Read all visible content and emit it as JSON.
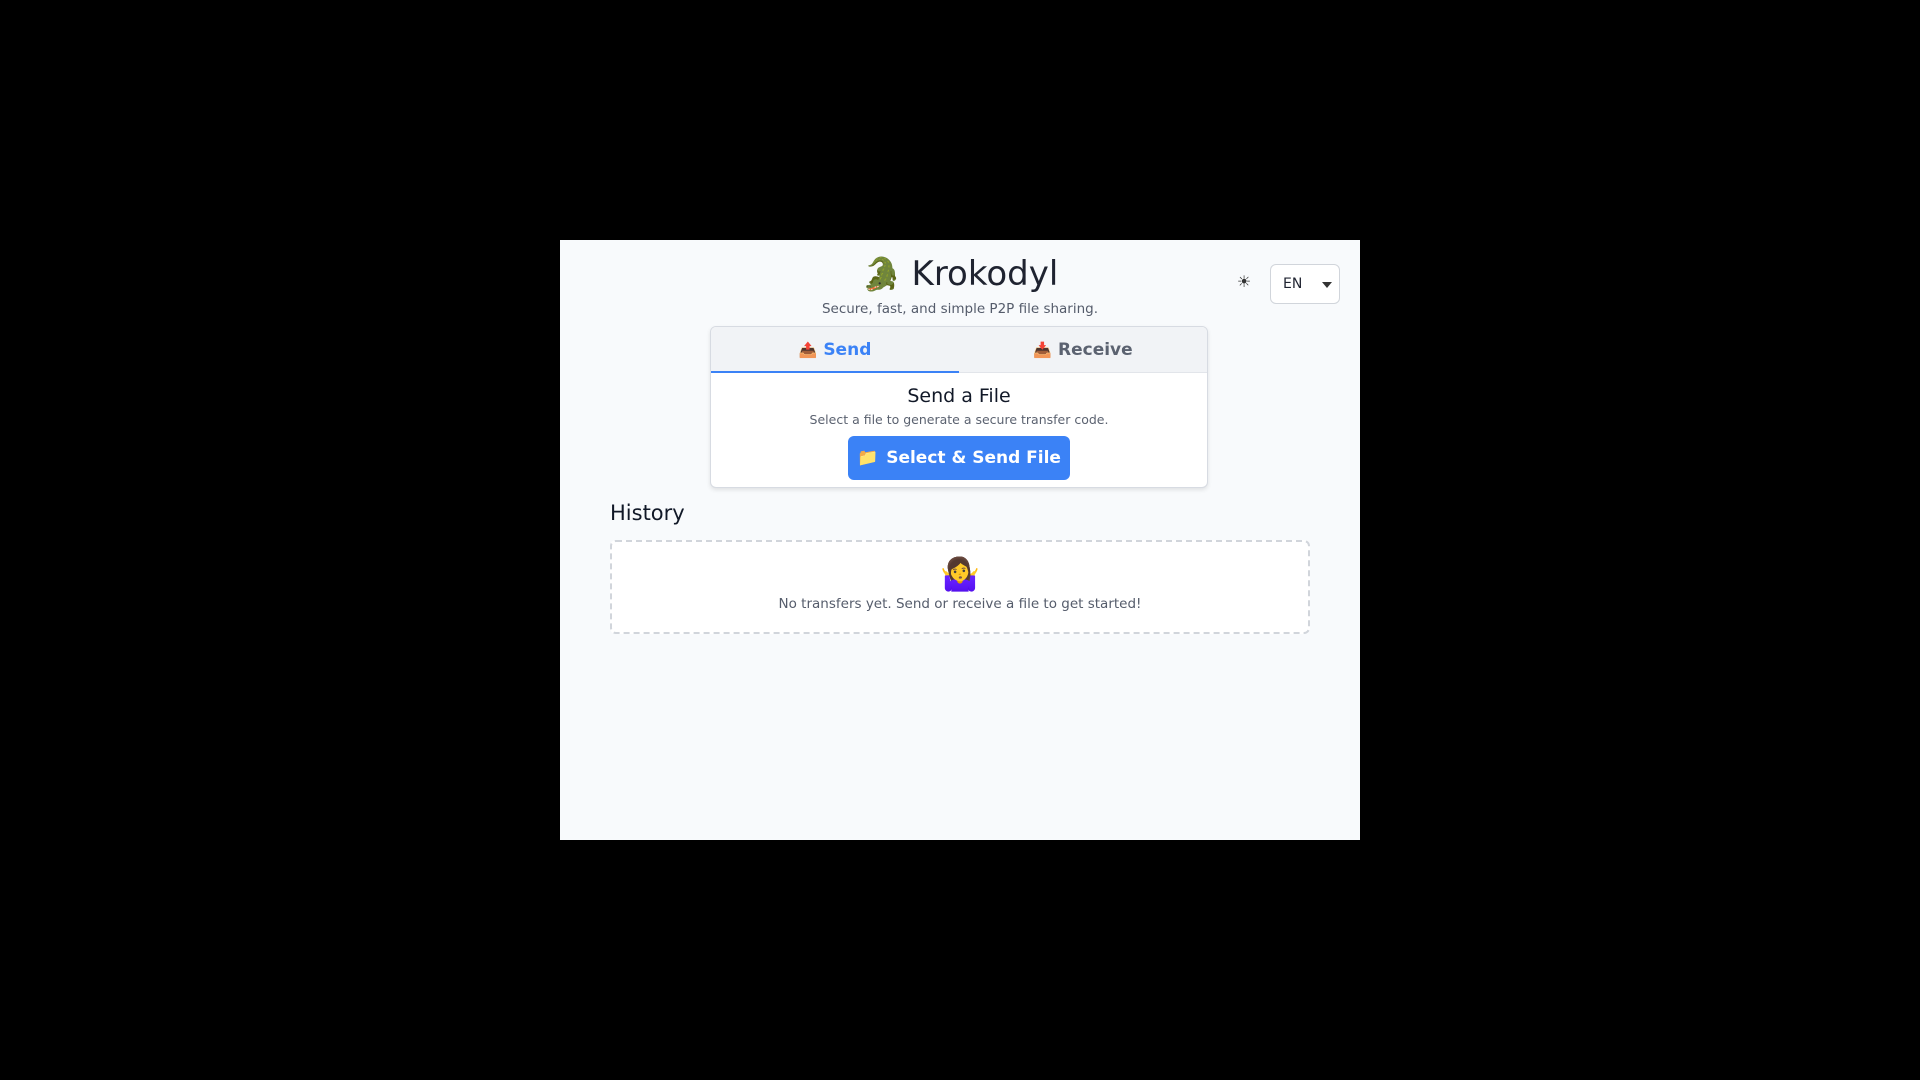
{
  "app": {
    "logo": "🐊",
    "title": "Krokodyl",
    "subtitle": "Secure, fast, and simple P2P file sharing."
  },
  "controls": {
    "theme_icon": "☀",
    "language": "EN"
  },
  "tabs": [
    {
      "icon": "📤",
      "label": "Send",
      "active": true
    },
    {
      "icon": "📥",
      "label": "Receive",
      "active": false
    }
  ],
  "send": {
    "title": "Send a File",
    "description": "Select a file to generate a secure transfer code.",
    "button_icon": "📁",
    "button_label": "Select & Send File"
  },
  "history": {
    "title": "History",
    "empty_icon": "🤷‍♀️",
    "empty_text": "No transfers yet. Send or receive a file to get started!"
  },
  "colors": {
    "accent": "#3b82f6",
    "background": "#f8fafc",
    "outer": "#000000"
  }
}
